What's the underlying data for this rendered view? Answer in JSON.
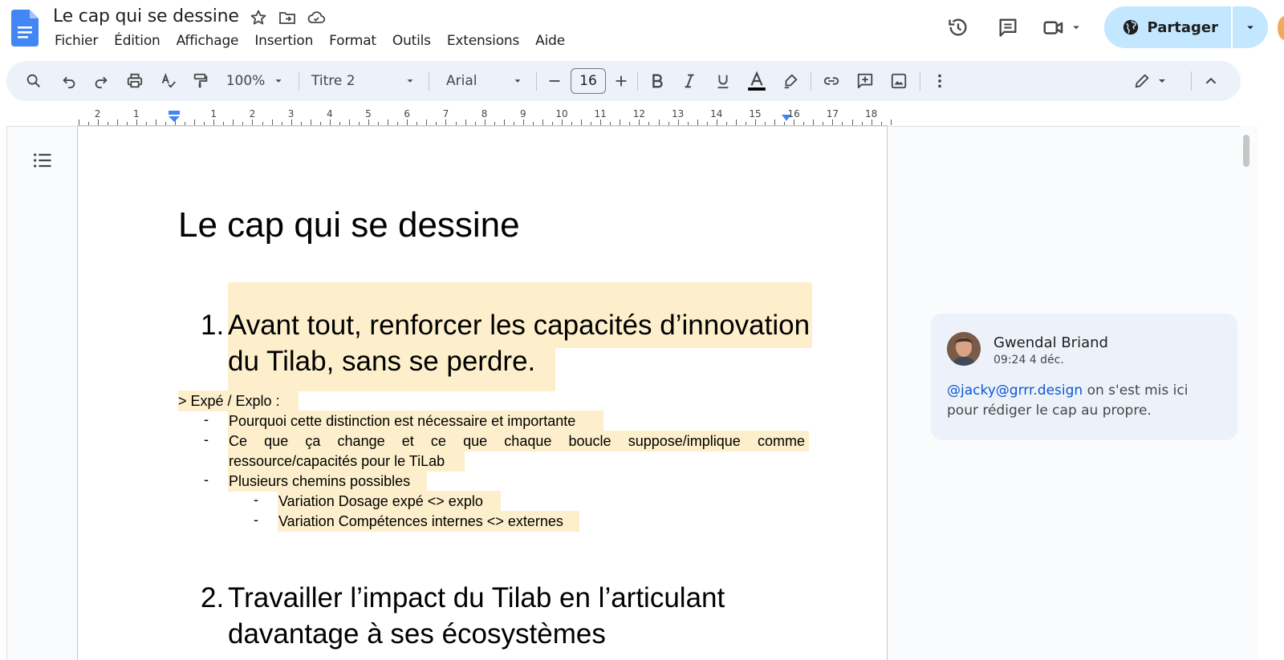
{
  "app": {
    "doc_title": "Le cap qui se dessine",
    "menu": [
      "Fichier",
      "Édition",
      "Affichage",
      "Insertion",
      "Format",
      "Outils",
      "Extensions",
      "Aide"
    ],
    "share_label": "Partager"
  },
  "toolbar": {
    "zoom": "100%",
    "style": "Titre 2",
    "font": "Arial",
    "font_size": "16"
  },
  "ruler": {
    "labels": [
      "2",
      "1",
      "1",
      "2",
      "3",
      "4",
      "5",
      "6",
      "7",
      "8",
      "9",
      "10",
      "11",
      "12",
      "13",
      "14",
      "15",
      "16",
      "17",
      "18"
    ]
  },
  "document": {
    "title": "Le cap qui se dessine",
    "section1": {
      "number": "1.",
      "line1": "Avant tout, renforcer les capacités d’innovation",
      "line2": "du Tilab, sans se perdre."
    },
    "expe_label": "> Expé / Explo :",
    "bullets": [
      "Pourquoi cette distinction est nécessaire et importante",
      "Ce que ça change et ce que chaque boucle suppose/implique comme",
      "ressource/capacités pour le TiLab",
      "Plusieurs chemins possibles"
    ],
    "sub_bullets": [
      "Variation Dosage expé <> explo",
      "Variation Compétences internes <> externes"
    ],
    "dash": "-",
    "section2": {
      "number": "2.",
      "line1": "Travailler l’impact du Tilab en l’articulant",
      "line2": "davantage à ses écosystèmes"
    }
  },
  "comment": {
    "author": "Gwendal Briand",
    "time": "09:24 4 déc.",
    "mention": "@jacky@grrr.design",
    "text_after_mention": " on s'est mis ici",
    "text_line2": "pour rédiger le cap au propre."
  },
  "colors": {
    "highlight": "#fdefcc",
    "share_bg": "#c2e7ff",
    "toolbar_bg": "#edf2fa",
    "mention": "#0b57d0"
  }
}
